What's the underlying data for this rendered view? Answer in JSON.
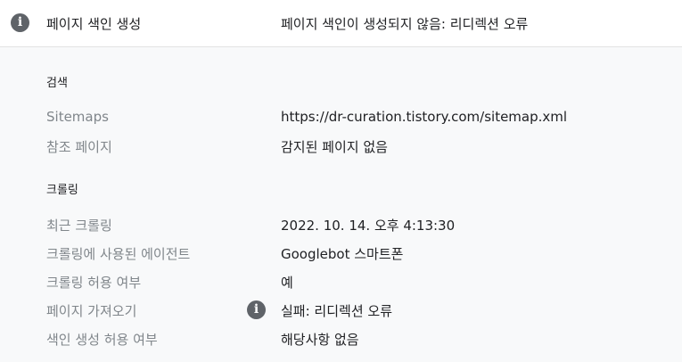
{
  "header": {
    "label": "페이지 색인 생성",
    "value": "페이지 색인이 생성되지 않음: 리디렉션 오류",
    "icon": "info-icon"
  },
  "sections": [
    {
      "title": "검색",
      "rows": [
        {
          "label": "Sitemaps",
          "value": "https://dr-curation.tistory.com/sitemap.xml"
        },
        {
          "label": "참조 페이지",
          "value": "감지된 페이지 없음"
        }
      ]
    },
    {
      "title": "크롤링",
      "rows": [
        {
          "label": "최근 크롤링",
          "value": "2022. 10. 14. 오후 4:13:30"
        },
        {
          "label": "크롤링에 사용된 에이전트",
          "value": "Googlebot 스마트폰"
        },
        {
          "label": "크롤링 허용 여부",
          "value": "예"
        },
        {
          "label": "페이지 가져오기",
          "value": "실패: 리디렉션 오류",
          "icon": "info-icon"
        },
        {
          "label": "색인 생성 허용 여부",
          "value": "해당사항 없음"
        }
      ]
    }
  ],
  "colors": {
    "label": "#80868b",
    "value": "#202124",
    "icon": "#5f6368",
    "panel": "#f8f9fa"
  }
}
